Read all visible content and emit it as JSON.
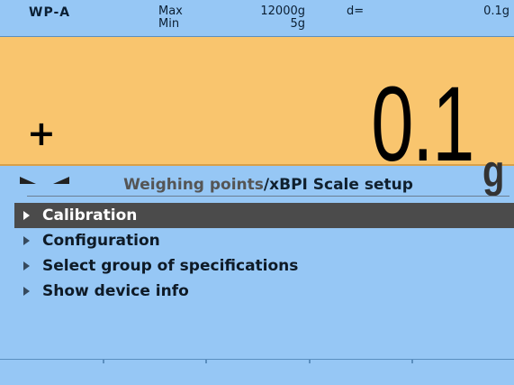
{
  "header": {
    "device_name": "WP-A",
    "max_label": "Max",
    "max_value": "12000g",
    "min_label": "Min",
    "min_value": "5g",
    "d_label": "d=",
    "d_value": "0.1g"
  },
  "display": {
    "sign": "+",
    "weight": "0.1",
    "unit": "g",
    "stability_icon": "stability-brackets"
  },
  "menu": {
    "path_parent": "Weighing points",
    "path_separator": "/",
    "path_current": "xBPI Scale setup",
    "selected_index": 0,
    "items": [
      {
        "label": "Calibration"
      },
      {
        "label": "Configuration"
      },
      {
        "label": "Select group of specifications"
      },
      {
        "label": "Show device info"
      }
    ]
  },
  "colors": {
    "background": "#96c7f5",
    "display_bg": "#f9c56e",
    "selected_row": "#4b4b4b"
  }
}
